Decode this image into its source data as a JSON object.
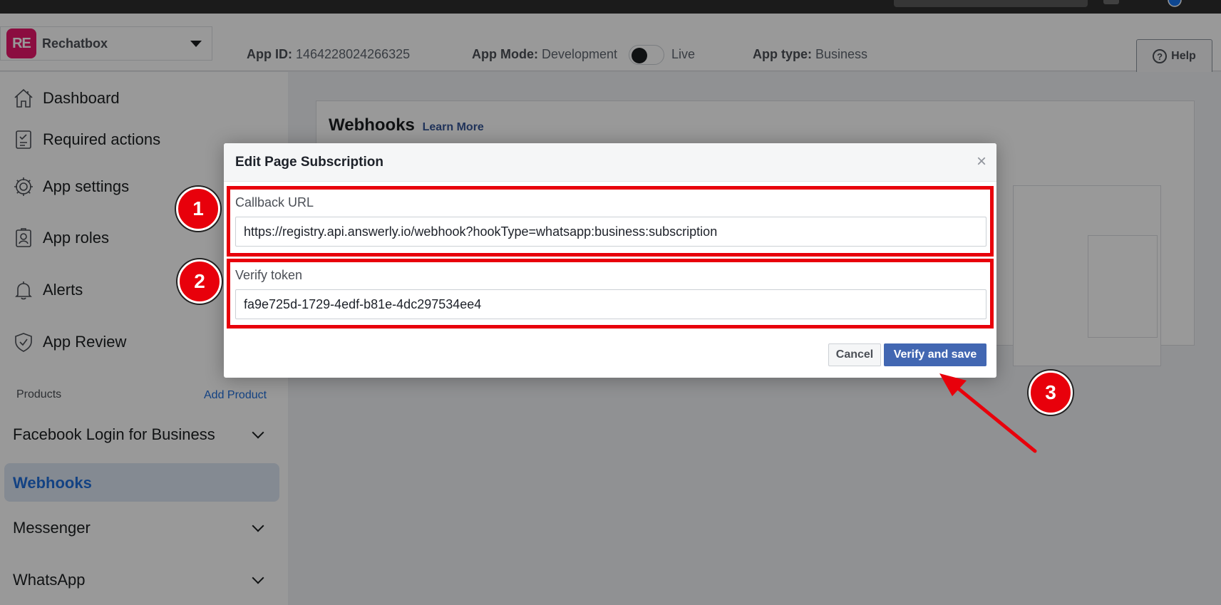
{
  "app": {
    "name": "Rechatbox",
    "logo_text": "RE",
    "app_id_label": "App ID:",
    "app_id": "1464228024266325",
    "mode_label": "App Mode:",
    "mode_value": "Development",
    "mode_alt": "Live",
    "type_label": "App type:",
    "type_value": "Business",
    "help_label": "Help"
  },
  "sidebar": {
    "items": [
      {
        "label": "Dashboard",
        "icon": "home-icon"
      },
      {
        "label": "Required actions",
        "icon": "checklist-icon"
      },
      {
        "label": "App settings",
        "icon": "gear-icon"
      },
      {
        "label": "App roles",
        "icon": "id-badge-icon"
      },
      {
        "label": "Alerts",
        "icon": "bell-icon"
      },
      {
        "label": "App Review",
        "icon": "shield-check-icon"
      }
    ],
    "products_label": "Products",
    "add_product": "Add Product",
    "products": [
      {
        "label": "Facebook Login for Business"
      },
      {
        "label": "Webhooks"
      },
      {
        "label": "Messenger"
      },
      {
        "label": "WhatsApp"
      }
    ]
  },
  "main": {
    "title": "Webhooks",
    "learn_more": "Learn More"
  },
  "modal": {
    "title": "Edit Page Subscription",
    "close": "×",
    "callback_label": "Callback URL",
    "callback_value": "https://registry.api.answerly.io/webhook?hookType=whatsapp:business:subscription",
    "token_label": "Verify token",
    "token_value": "fa9e725d-1729-4edf-b81e-4dc297534ee4",
    "cancel": "Cancel",
    "save": "Verify and save"
  },
  "annotations": {
    "step1": "1",
    "step2": "2",
    "step3": "3",
    "color": "#e8000b"
  },
  "colors": {
    "accent": "#4267b2",
    "link": "#216fdb",
    "highlight": "#e8000b"
  }
}
